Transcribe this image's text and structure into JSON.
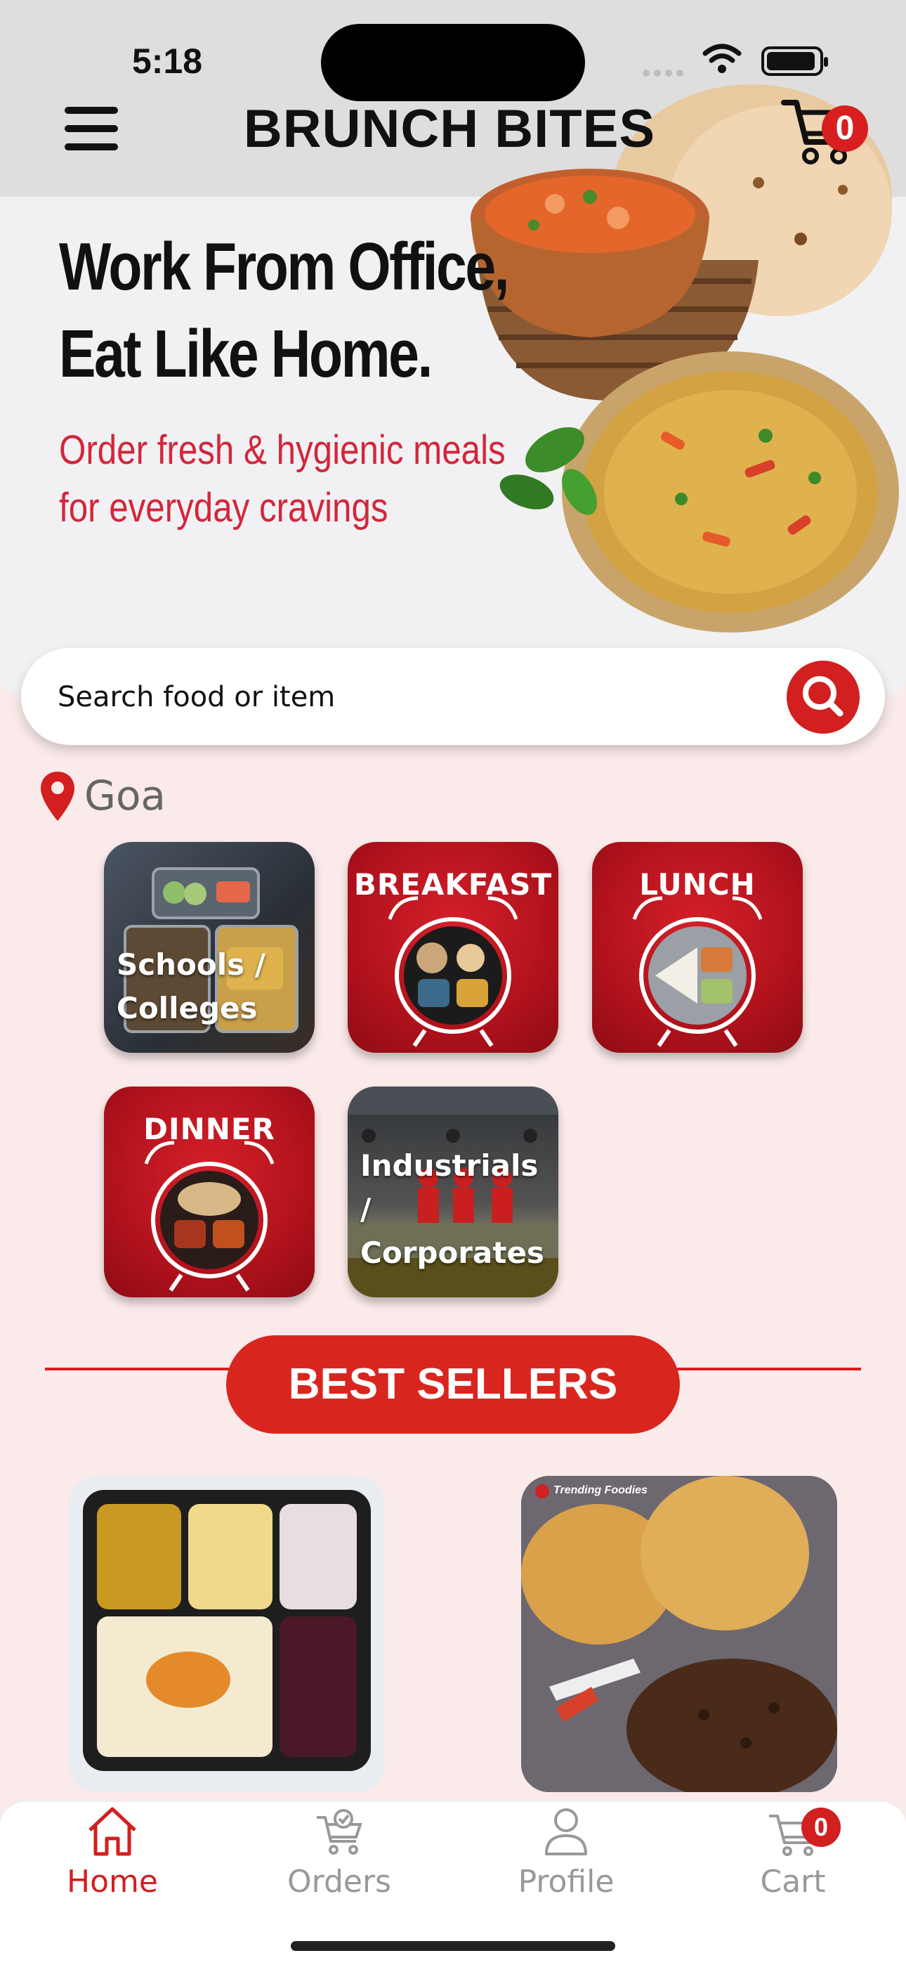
{
  "status_bar": {
    "time": "5:18"
  },
  "header": {
    "brand": "BRUNCH BITES",
    "cart_count": "0"
  },
  "hero": {
    "headline_line1": "Work From Office,",
    "headline_line2": "Eat Like Home.",
    "subline_line1": "Order fresh & hygienic meals",
    "subline_line2": "for everyday cravings"
  },
  "search": {
    "placeholder": "Search food or item"
  },
  "location": {
    "city": "Goa"
  },
  "categories": [
    {
      "label_line1": "Schools /",
      "label_line2": "Colleges"
    },
    {
      "label": "BREAKFAST"
    },
    {
      "label": "LUNCH"
    },
    {
      "label": "DINNER"
    },
    {
      "label_line1": "Industrials /",
      "label_line2": "Corporates"
    }
  ],
  "best_sellers": {
    "title": "BEST SELLERS",
    "product_b_watermark": "Trending Foodies"
  },
  "tabbar": {
    "items": [
      {
        "label": "Home",
        "icon": "home-icon"
      },
      {
        "label": "Orders",
        "icon": "orders-icon"
      },
      {
        "label": "Profile",
        "icon": "profile-icon"
      },
      {
        "label": "Cart",
        "icon": "cart-icon",
        "badge": "0"
      }
    ]
  },
  "colors": {
    "accent": "#d21f1f",
    "background": "#fbeaea",
    "hero_text": "#d3263b"
  }
}
